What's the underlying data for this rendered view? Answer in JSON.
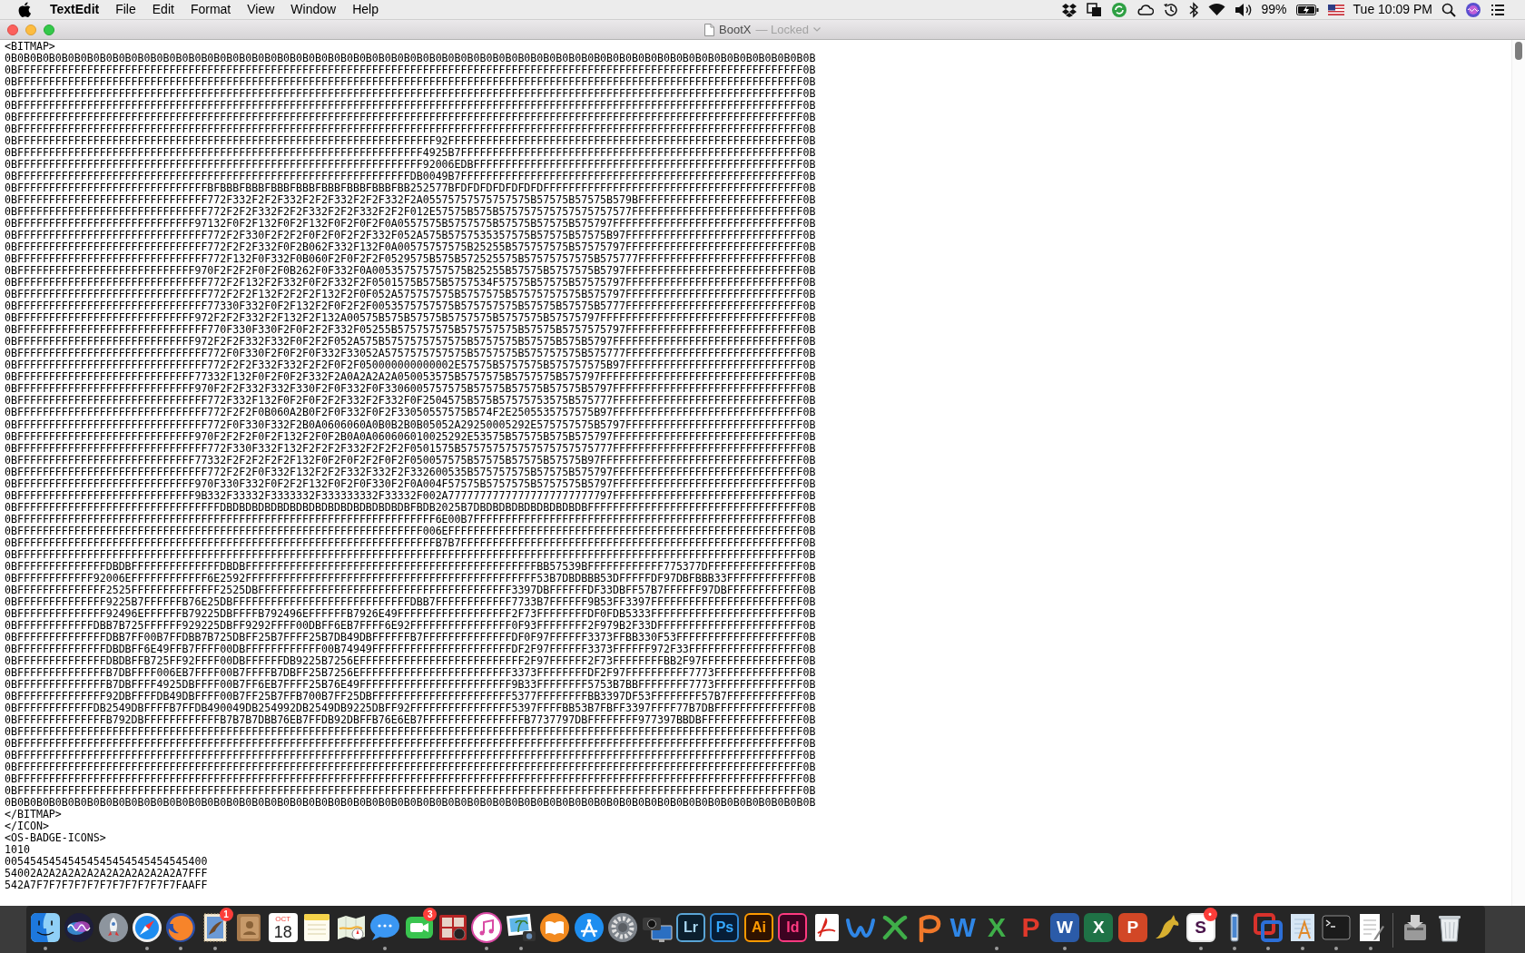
{
  "menu_bar": {
    "app_name": "TextEdit",
    "menus": [
      "File",
      "Edit",
      "Format",
      "View",
      "Window",
      "Help"
    ],
    "battery": "99%",
    "clock": "Tue 10:09 PM"
  },
  "window": {
    "title": "BootX",
    "status": "— Locked"
  },
  "document": {
    "lines": [
      "<BITMAP>",
      "0B0B0B0B0B0B0B0B0B0B0B0B0B0B0B0B0B0B0B0B0B0B0B0B0B0B0B0B0B0B0B0B0B0B0B0B0B0B0B0B0B0B0B0B0B0B0B0B0B0B0B0B0B0B0B0B0B0B0B0B0B0B0B0B",
      "0BFFFFFFFFFFFFFFFFFFFFFFFFFFFFFFFFFFFFFFFFFFFFFFFFFFFFFFFFFFFFFFFFFFFFFFFFFFFFFFFFFFFFFFFFFFFFFFFFFFFFFFFFFFFFFFFFFFFFFFFFFFFF0B",
      "0BFFFFFFFFFFFFFFFFFFFFFFFFFFFFFFFFFFFFFFFFFFFFFFFFFFFFFFFFFFFFFFFFFFFFFFFFFFFFFFFFFFFFFFFFFFFFFFFFFFFFFFFFFFFFFFFFFFFFFFFFFFFF0B",
      "0BFFFFFFFFFFFFFFFFFFFFFFFFFFFFFFFFFFFFFFFFFFFFFFFFFFFFFFFFFFFFFFFFFFFFFFFFFFFFFFFFFFFFFFFFFFFFFFFFFFFFFFFFFFFFFFFFFFFFFFFFFFFF0B",
      "0BFFFFFFFFFFFFFFFFFFFFFFFFFFFFFFFFFFFFFFFFFFFFFFFFFFFFFFFFFFFFFFFFFFFFFFFFFFFFFFFFFFFFFFFFFFFFFFFFFFFFFFFFFFFFFFFFFFFFFFFFFFFF0B",
      "0BFFFFFFFFFFFFFFFFFFFFFFFFFFFFFFFFFFFFFFFFFFFFFFFFFFFFFFFFFFFFFFFFFFFFFFFFFFFFFFFFFFFFFFFFFFFFFFFFFFFFFFFFFFFFFFFFFFFFFFFFFFFF0B",
      "0BFFFFFFFFFFFFFFFFFFFFFFFFFFFFFFFFFFFFFFFFFFFFFFFFFFFFFFFFFFFFFFFFFFFFFFFFFFFFFFFFFFFFFFFFFFFFFFFFFFFFFFFFFFFFFFFFFFFFFFFFFFFF0B",
      "0BFFFFFFFFFFFFFFFFFFFFFFFFFFFFFFFFFFFFFFFFFFFFFFFFFFFFFFFFFFFFFFFFFF92FFFFFFFFFFFFFFFFFFFFFFFFFFFFFFFFFFFFFFFFFFFFFFFFFFFFFFFF0B",
      "0BFFFFFFFFFFFFFFFFFFFFFFFFFFFFFFFFFFFFFFFFFFFFFFFFFFFFFFFFFFFFFFFF4925B7FFFFFFFFFFFFFFFFFFFFFFFFFFFFFFFFFFFFFFFFFFFFFFFFFFFFFF0B",
      "0BFFFFFFFFFFFFFFFFFFFFFFFFFFFFFFFFFFFFFFFFFFFFFFFFFFFFFFFFFFFFFFFF92006EDBFFFFFFFFFFFFFFFFFFFFFFFFFFFFFFFFFFFFFFFFFFFFFFFFFFFF0B",
      "0BFFFFFFFFFFFFFFFFFFFFFFFFFFFFFFFFFFFFFFFFFFFFFFFFFFFFFFFFFFFFFFDB0049B7FFFFFFFFFFFFFFFFFFFFFFFFFFFFFFFFFFFFFFFFFFFFFFFFFFFFFF0B",
      "0BFFFFFFFFFFFFFFFFFFFFFFFFFFFFFFBFBBBFBBBFBBBFBBBFBBBFBBBFBBBFBB252577BFDFDFDFDFDFDFDFFFFFFFFFFFFFFFFFFFFFFFFFFFFFFFFFFFFFFFFF0B",
      "0BFFFFFFFFFFFFFFFFFFFFFFFFFFFFFF772F332F2F2F332F2F2F332F2F2F332F2A05575757575757575B57575B57575B579BFFFFFFFFFFFFFFFFFFFFFFFFFF0B",
      "0BFFFFFFFFFFFFFFFFFFFFFFFFFFFFFF772F2F2F332F2F2F332F2F2F332F2F2F012E57575B575B575757575757575757577FFFFFFFFFFFFFFFFFFFFFFFFFFF0B",
      "0BFFFFFFFFFFFFFFFFFFFFFFFFFFFF97132F0F2F132F0F2F132F0F2F0F2F0A0557575B5757575B57575B57575B575797FFFFFFFFFFFFFFFFFFFFFFFFFFFFFF0B",
      "0BFFFFFFFFFFFFFFFFFFFFFFFFFFFFFF772F2F330F2F2F2F0F2F0F2F2F332F052A575B5757535357575B57575B57575B97FFFFFFFFFFFFFFFFFFFFFFFFFFFF0B",
      "0BFFFFFFFFFFFFFFFFFFFFFFFFFFFFFF772F2F2F332F0F2B062F332F132F0A00575757575B25255B575757575B57575797FFFFFFFFFFFFFFFFFFFFFFFFFFFF0B",
      "0BFFFFFFFFFFFFFFFFFFFFFFFFFFFFFF772F132F0F332F0B060F2F0F2F2F0529575B575B572525575B57575757575B575777FFFFFFFFFFFFFFFFFFFFFFFFFF0B",
      "0BFFFFFFFFFFFFFFFFFFFFFFFFFFFF970F2F2F2F0F2F0B262F0F332F0A005357575757575B25255B57575B5757575B5797FFFFFFFFFFFFFFFFFFFFFFFFFFFF0B",
      "0BFFFFFFFFFFFFFFFFFFFFFFFFFFFFFF772F2F132F2F332F0F2F332F2F0501575B575B5757534F57575B57575B57575797FFFFFFFFFFFFFFFFFFFFFFFFFFFF0B",
      "0BFFFFFFFFFFFFFFFFFFFFFFFFFFFFFF772F2F2F132F2F2F2F132F2F0F052A575757575B5757575B57575757575B575797FFFFFFFFFFFFFFFFFFFFFFFFFFFF0B",
      "0BFFFFFFFFFFFFFFFFFFFFFFFFFFFFFF77330F332F0F2F132F2F0F2F2F0053575757575B575757575B57575B57575B5777FFFFFFFFFFFFFFFFFFFFFFFFFFFF0B",
      "0BFFFFFFFFFFFFFFFFFFFFFFFFFFFF972F2F2F332F2F132F2F132A00575B575B57575B5757575B5757575B57575797FFFFFFFFFFFFFFFFFFFFFFFFFFFFFFFF0B",
      "0BFFFFFFFFFFFFFFFFFFFFFFFFFFFFFF770F330F330F2F0F2F2F332F05255B575757575B575757575B57575B5757575797FFFFFFFFFFFFFFFFFFFFFFFFFFFF0B",
      "0BFFFFFFFFFFFFFFFFFFFFFFFFFFFF972F2F2F332F332F0F2F2F052A575B5757575757575B5757575B57575B575B5797FFFFFFFFFFFFFFFFFFFFFFFFFFFFFF0B",
      "0BFFFFFFFFFFFFFFFFFFFFFFFFFFFFFF772F0F330F2F0F2F0F332F33052A5757575757575B5757575B575757575B575777FFFFFFFFFFFFFFFFFFFFFFFFFFFF0B",
      "0BFFFFFFFFFFFFFFFFFFFFFFFFFFFFFF772F2F2F332F332F2F2F0F2F050000000000002E57575B5757575B575757575B97FFFFFFFFFFFFFFFFFFFFFFFFFFFF0B",
      "0BFFFFFFFFFFFFFFFFFFFFFFFFFFFF77332F132F0F2F0F2F332F2A0A2A2A2A050053575B5757575B5757575B575797FFFFFFFFFFFFFFFFFFFFFFFFFFFFFFFF0B",
      "0BFFFFFFFFFFFFFFFFFFFFFFFFFFFF970F2F2F332F332F330F2F0F332F0F3306005757575B57575B57575B57575B5797FFFFFFFFFFFFFFFFFFFFFFFFFFFFFF0B",
      "0BFFFFFFFFFFFFFFFFFFFFFFFFFFFFFF772F332F132F0F2F0F2F2F332F2F332F0F2504575B575B57575753575B575777FFFFFFFFFFFFFFFFFFFFFFFFFFFFFF0B",
      "0BFFFFFFFFFFFFFFFFFFFFFFFFFFFFFF772F2F2F0B060A2B0F2F0F332F0F2F33050557575B574F2E2505535757575B97FFFFFFFFFFFFFFFFFFFFFFFFFFFFFF0B",
      "0BFFFFFFFFFFFFFFFFFFFFFFFFFFFFFF772F0F330F332F2B0A0606060A0B0B2B0B05052A29250005292E575757575B5797FFFFFFFFFFFFFFFFFFFFFFFFFFFF0B",
      "0BFFFFFFFFFFFFFFFFFFFFFFFFFFFF970F2F2F2F0F2F132F2F0F2B0A0A060606010025292E53575B57575B575B575797FFFFFFFFFFFFFFFFFFFFFFFFFFFFFF0B",
      "0BFFFFFFFFFFFFFFFFFFFFFFFFFFFFFF772F330F332F132F2F2F2F332F2F2F2F0501575B575757575757575757575777FFFFFFFFFFFFFFFFFFFFFFFFFFFFFF0B",
      "0BFFFFFFFFFFFFFFFFFFFFFFFFFFFF77332F2F2F2F2F2F132F0F2F0F2F2F0F2F050057575B57575B57575B57575B97FFFFFFFFFFFFFFFFFFFFFFFFFFFFFFFF0B",
      "0BFFFFFFFFFFFFFFFFFFFFFFFFFFFFFF772F2F2F0F332F132F2F2F332F332F2F332600535B575757575B57575B575797FFFFFFFFFFFFFFFFFFFFFFFFFFFFFF0B",
      "0BFFFFFFFFFFFFFFFFFFFFFFFFFFFF970F330F332F0F2F2F132F0F2F0F330F2F0A004F57575B5757575B5757575B5797FFFFFFFFFFFFFFFFFFFFFFFFFFFFFF0B",
      "0BFFFFFFFFFFFFFFFFFFFFFFFFFFFF9B332F33332F3333332F333333332F33332F002A77777777777777777777777797FFFFFFFFFFFFFFFFFFFFFFFFFFFFFF0B",
      "0BFFFFFFFFFFFFFFFFFFFFFFFFFFFFFFFFDBDBDBDBDBDBDBDBDBDBDBDBDBDBDBFBDB2025B7DBDBDBDBDBDBDBDBDBFFFFFFFFFFFFFFFFFFFFFFFFFFFFFFFFFF0B",
      "0BFFFFFFFFFFFFFFFFFFFFFFFFFFFFFFFFFFFFFFFFFFFFFFFFFFFFFFFFFFFFFFFFFF6E00B7FFFFFFFFFFFFFFFFFFFFFFFFFFFFFFFFFFFFFFFFFFFFFFFFFFFF0B",
      "0BFFFFFFFFFFFFFFFFFFFFFFFFFFFFFFFFFFFFFFFFFFFFFFFFFFFFFFFFFFFFFFFF006EFFFFFFFFFFFFFFFFFFFFFFFFFFFFFFFFFFFFFFFFFFFFFFFFFFFFFFFF0B",
      "0BFFFFFFFFFFFFFFFFFFFFFFFFFFFFFFFFFFFFFFFFFFFFFFFFFFFFFFFFFFFFFFFFFFB7B7FFFFFFFFFFFFFFFFFFFFFFFFFFFFFFFFFFFFFFFFFFFFFFFFFFFFFF0B",
      "0BFFFFFFFFFFFFFFFFFFFFFFFFFFFFFFFFFFFFFFFFFFFFFFFFFFFFFFFFFFFFFFFFFFFFFFFFFFFFFFFFFFFFFFFFFFFFFFFFFFFFFFFFFFFFFFFFFFFFFFFFFFFF0B",
      "0BFFFFFFFFFFFFFFDBDBFFFFFFFFFFFFFFDBDBFFFFFFFFFFFFFFFFFFFFFFFFFFFFFFFFFFFFFFFFFFFFFFBB57539BFFFFFFFFFFFF775377DFFFFFFFFFFFFFFF0B",
      "0BFFFFFFFFFFFF92006EFFFFFFFFFFFF6E2592FFFFFFFFFFFFFFFFFFFFFFFFFFFFFFFFFFFFFFFFFFFFFF53B7DBDBBB53DFFFFFDF97DBFBBB33FFFFFFFFFFFF0B",
      "0BFFFFFFFFFFFFFF2525FFFFFFFFFFFFFF2525DBFFFFFFFFFFFFFFFFFFFFFFFFFFFFFFFFFFFFFFFF3397DBFFFFFFDF33DBFF57B7FFFFFF97DBFFFFFFFFFFFF0B",
      "0BFFFFFFFFFFFFFF9225B7FFFFFFB76E25DBFFFFFFFFFFFFFFFFFFFFFFFFFFFFDBB7FFFFFFFFFFFF7733B7FFFFFF9B53FF3397FFFFFFFFFFFFFFFFFFFFFFFF0B",
      "0BFFFFFFFFFFFFFF92496EFFFFFFB79225DBFFFFB792496EFFFFFFB7926E49FFFFFFFFFFFFFFFFFF2F73FFFFFFFFDF0FDB5333FFFFFFFFFFFFFFFFFFFFFFFF0B",
      "0BFFFFFFFFFFFFDBB7B725FFFFFF929225DBFF9292FFFF00DBFF6EB7FFFF6E92FFFFFFFFFFFFFFFF0F93FFFFFFFF2F979B2F33DFFFFFFFFFFFFFFFFFFFFFFF0B",
      "0BFFFFFFFFFFFFFFDBB7FF00B7FFDBB7B725DBFF25B7FFFF25B7DB49DBFFFFFFB7FFFFFFFFFFFFFFDF0F97FFFFFF3373FFBB330F53FFFFFFFFFFFFFFFFFFFF0B",
      "0BFFFFFFFFFFFFFFDBDBFF6E49FFB7FFFF00DBFFFFFFFFFFFF00B74949FFFFFFFFFFFFFFFFFFFFFFDF2F97FFFFFF3373FFFFFF972F33FFFFFFFFFFFFFFFFFF0B",
      "0BFFFFFFFFFFFFFFDBDBFFB725FF92FFFF00DBFFFFFFDB9225B7256EFFFFFFFFFFFFFFFFFFFFFFFFFF2F97FFFFFF2F73FFFFFFFFBB2F97FFFFFFFFFFFFFFFF0B",
      "0BFFFFFFFFFFFFFFB7DBFFFF006EB7FFFF00B7FFFFB7DBFF25B7256EFFFFFFFFFFFFFFFFFFFFFFFF3373FFFFFFFFDF2F97FFFFFFFFFF7773FFFFFFFFFFFFFF0B",
      "0BFFFFFFFFFFFFFFB7DBFFFF4925DBFFFF00B7FF6EB7FFFF25B76E49FFFFFFFFFFFFFFFFFFFFFFFF9B33FFFFFFFF5753B7BBFFFFFFFF7773FFFFFFFFFFFFFF0B",
      "0BFFFFFFFFFFFFFF92DBFFFFDB49DBFFFF00B7FF25B7FFB700B7FF25DBFFFFFFFFFFFFFFFFFFFFFF5377FFFFFFFFBB3397DF53FFFFFFFF57B7FFFFFFFFFFFF0B",
      "0BFFFFFFFFFFFFDB2549DBFFFFB7FFDB490049DB254992DB2549DB9225DBFF92FFFFFFFFFFFFFFFF5397FFFFBB53B7FBFF3397FFFF77B7DBFFFFFFFFFFFFFF0B",
      "0BFFFFFFFFFFFFFFB792DBFFFFFFFFFFFFB7B7B7DBB76EB7FFDB92DBFFB76E6EB7FFFFFFFFFFFFFFFFB7737797DBFFFFFFFF977397BBDBFFFFFFFFFFFFFFFF0B",
      "0BFFFFFFFFFFFFFFFFFFFFFFFFFFFFFFFFFFFFFFFFFFFFFFFFFFFFFFFFFFFFFFFFFFFFFFFFFFFFFFFFFFFFFFFFFFFFFFFFFFFFFFFFFFFFFFFFFFFFFFFFFFFF0B",
      "0BFFFFFFFFFFFFFFFFFFFFFFFFFFFFFFFFFFFFFFFFFFFFFFFFFFFFFFFFFFFFFFFFFFFFFFFFFFFFFFFFFFFFFFFFFFFFFFFFFFFFFFFFFFFFFFFFFFFFFFFFFFFF0B",
      "0BFFFFFFFFFFFFFFFFFFFFFFFFFFFFFFFFFFFFFFFFFFFFFFFFFFFFFFFFFFFFFFFFFFFFFFFFFFFFFFFFFFFFFFFFFFFFFFFFFFFFFFFFFFFFFFFFFFFFFFFFFFFF0B",
      "0BFFFFFFFFFFFFFFFFFFFFFFFFFFFFFFFFFFFFFFFFFFFFFFFFFFFFFFFFFFFFFFFFFFFFFFFFFFFFFFFFFFFFFFFFFFFFFFFFFFFFFFFFFFFFFFFFFFFFFFFFFFFF0B",
      "0BFFFFFFFFFFFFFFFFFFFFFFFFFFFFFFFFFFFFFFFFFFFFFFFFFFFFFFFFFFFFFFFFFFFFFFFFFFFFFFFFFFFFFFFFFFFFFFFFFFFFFFFFFFFFFFFFFFFFFFFFFFFF0B",
      "0BFFFFFFFFFFFFFFFFFFFFFFFFFFFFFFFFFFFFFFFFFFFFFFFFFFFFFFFFFFFFFFFFFFFFFFFFFFFFFFFFFFFFFFFFFFFFFFFFFFFFFFFFFFFFFFFFFFFFFFFFFFFF0B",
      "0B0B0B0B0B0B0B0B0B0B0B0B0B0B0B0B0B0B0B0B0B0B0B0B0B0B0B0B0B0B0B0B0B0B0B0B0B0B0B0B0B0B0B0B0B0B0B0B0B0B0B0B0B0B0B0B0B0B0B0B0B0B0B0B",
      "</BITMAP>",
      "</ICON>",
      "<OS-BADGE-ICONS>",
      "1010",
      "00545454545454545454545454545400",
      "54002A2A2A2A2A2A2A2A2A2A2A2A7FFF",
      "542A7F7F7F7F7F7F7F7F7F7F7F7FAAFF"
    ]
  },
  "dock": {
    "items": [
      {
        "kind": "art",
        "running": true
      },
      {
        "kind": "art",
        "running": false
      },
      {
        "kind": "art",
        "running": false
      },
      {
        "kind": "art",
        "running": true
      },
      {
        "kind": "art",
        "running": true
      },
      {
        "kind": "art",
        "running": true,
        "badge": "1"
      },
      {
        "kind": "art",
        "running": false
      },
      {
        "kind": "calendar",
        "running": false,
        "month": "OCT",
        "day": "18"
      },
      {
        "kind": "art",
        "running": false
      },
      {
        "kind": "art",
        "running": false
      },
      {
        "kind": "art",
        "running": true
      },
      {
        "kind": "art",
        "running": false,
        "badge": "3"
      },
      {
        "kind": "art",
        "running": false
      },
      {
        "kind": "art",
        "running": true
      },
      {
        "kind": "art",
        "running": true
      },
      {
        "kind": "art",
        "running": false
      },
      {
        "kind": "art",
        "running": false
      },
      {
        "kind": "art",
        "running": false
      },
      {
        "kind": "art",
        "running": false
      },
      {
        "kind": "letters",
        "running": false,
        "label": "Lr"
      },
      {
        "kind": "letters",
        "running": false,
        "label": "Ps"
      },
      {
        "kind": "letters",
        "running": false,
        "label": "Ai"
      },
      {
        "kind": "letters",
        "running": false,
        "label": "Id"
      },
      {
        "kind": "art",
        "running": false
      },
      {
        "kind": "art",
        "running": false
      },
      {
        "kind": "art",
        "running": false
      },
      {
        "kind": "art",
        "running": false
      },
      {
        "kind": "letters",
        "running": false,
        "label": "W"
      },
      {
        "kind": "letters",
        "running": true,
        "label": "X"
      },
      {
        "kind": "letters",
        "running": false,
        "label": "P"
      },
      {
        "kind": "letters",
        "running": true,
        "label": "W"
      },
      {
        "kind": "letters",
        "running": false,
        "label": "X"
      },
      {
        "kind": "letters",
        "running": false,
        "label": "P"
      },
      {
        "kind": "art",
        "running": false
      },
      {
        "kind": "letters",
        "running": true,
        "label": "S",
        "badge": "•"
      },
      {
        "kind": "art",
        "running": true
      },
      {
        "kind": "art",
        "running": true
      },
      {
        "kind": "art",
        "running": true
      },
      {
        "kind": "art",
        "running": true
      },
      {
        "kind": "art",
        "running": true
      },
      {
        "kind": "art",
        "running": false
      },
      {
        "kind": "art",
        "running": false
      }
    ]
  }
}
